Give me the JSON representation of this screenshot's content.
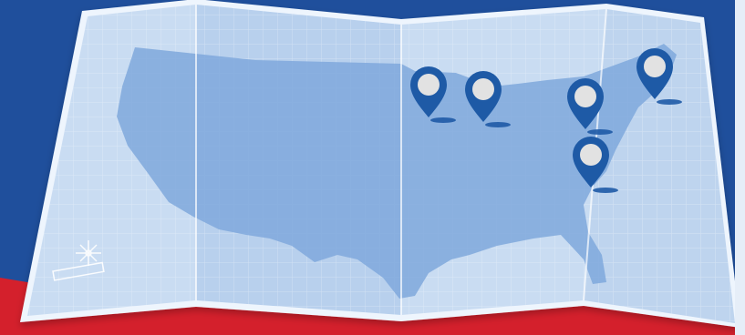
{
  "colors": {
    "background_blue": "#1f4f9c",
    "background_red": "#d4202c",
    "map_paper": "#c9dcf2",
    "map_panel_shade": "#a9c6e9",
    "map_border": "#eef5fd",
    "land": "#7fa8dc",
    "pin_blue": "#1e5aa6",
    "pin_center": "#e2e2e2",
    "right_panel": "#e6eef8"
  },
  "map": {
    "panel_count": 4,
    "pins": [
      {
        "name": "pin-minneapolis",
        "icon": "map-pin-icon"
      },
      {
        "name": "pin-milwaukee",
        "icon": "map-pin-icon"
      },
      {
        "name": "pin-pittsburgh",
        "icon": "map-pin-icon"
      },
      {
        "name": "pin-boston",
        "icon": "map-pin-icon"
      },
      {
        "name": "pin-charlotte",
        "icon": "map-pin-icon"
      }
    ],
    "decorations": [
      "compass-rose-icon",
      "scale-bar-icon"
    ]
  }
}
